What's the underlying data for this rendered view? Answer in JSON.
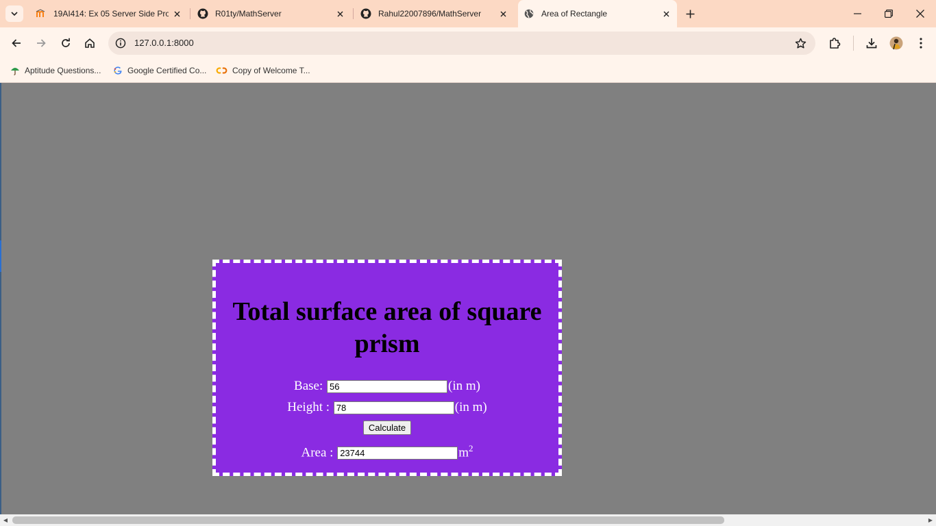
{
  "browser": {
    "tabs": [
      {
        "title": "19AI414: Ex 05 Server Side Proc",
        "icon": "moodle-icon",
        "active": false
      },
      {
        "title": "R01ty/MathServer",
        "icon": "github-icon",
        "active": false
      },
      {
        "title": "Rahul22007896/MathServer",
        "icon": "github-icon",
        "active": false
      },
      {
        "title": "Area of Rectangle",
        "icon": "globe-icon",
        "active": true
      }
    ],
    "url": "127.0.0.1:8000",
    "bookmarks": [
      {
        "label": "Aptitude Questions...",
        "icon": "umbrella-icon"
      },
      {
        "label": "Google Certified Co...",
        "icon": "google-icon"
      },
      {
        "label": "Copy of Welcome T...",
        "icon": "colab-icon"
      }
    ]
  },
  "page": {
    "heading": "Total surface area of square prism",
    "base_label": "Base:",
    "base_value": "56",
    "height_label": "Height :",
    "height_value": "78",
    "unit": "(in m)",
    "calculate_label": "Calculate",
    "area_label": "Area :",
    "area_value": "23744",
    "area_unit": "m",
    "area_unit_exp": "2"
  },
  "colors": {
    "card_background": "#8a2be2",
    "page_background": "#808080",
    "tabstrip": "#fcd9c4"
  }
}
